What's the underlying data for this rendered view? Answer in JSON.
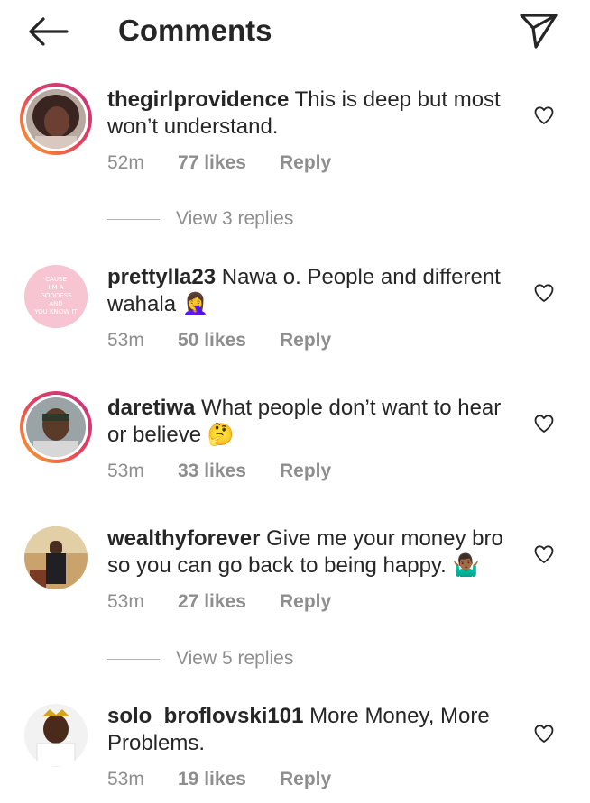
{
  "header": {
    "title": "Comments"
  },
  "comments": [
    {
      "username": "thegirlprovidence",
      "text": "This is deep but most won’t understand.",
      "time": "52m",
      "likes": "77 likes",
      "reply": "Reply",
      "avatar_ring": true
    },
    {
      "username": "prettylla23",
      "text": "Nawa o. People and different wahala 🤦‍♀️",
      "time": "53m",
      "likes": "50 likes",
      "reply": "Reply",
      "avatar_ring": false,
      "avatar_text": "CAUSE I'M A GODDESS AND YOU KNOW IT"
    },
    {
      "username": "daretiwa",
      "text": "What people don’t want to hear or believe 🤔",
      "time": "53m",
      "likes": "33 likes",
      "reply": "Reply",
      "avatar_ring": true
    },
    {
      "username": "wealthyforever",
      "text": "Give me your money bro so you can go back to being happy. 🤷🏾‍♂️",
      "time": "53m",
      "likes": "27 likes",
      "reply": "Reply",
      "avatar_ring": false
    },
    {
      "username": "solo_broflovski101",
      "text": "More Money, More Problems.",
      "time": "53m",
      "likes": "19 likes",
      "reply": "Reply",
      "avatar_ring": false
    }
  ],
  "view_replies": [
    {
      "label": "View 3 replies"
    },
    {
      "label": "View 5 replies"
    }
  ],
  "colors": {
    "text": "#262626",
    "muted": "#8e8e8e",
    "ring_start": "#f9a826",
    "ring_end": "#c13584"
  },
  "icons": {
    "back": "arrow-left-icon",
    "send": "paper-plane-icon",
    "like": "heart-outline-icon"
  }
}
